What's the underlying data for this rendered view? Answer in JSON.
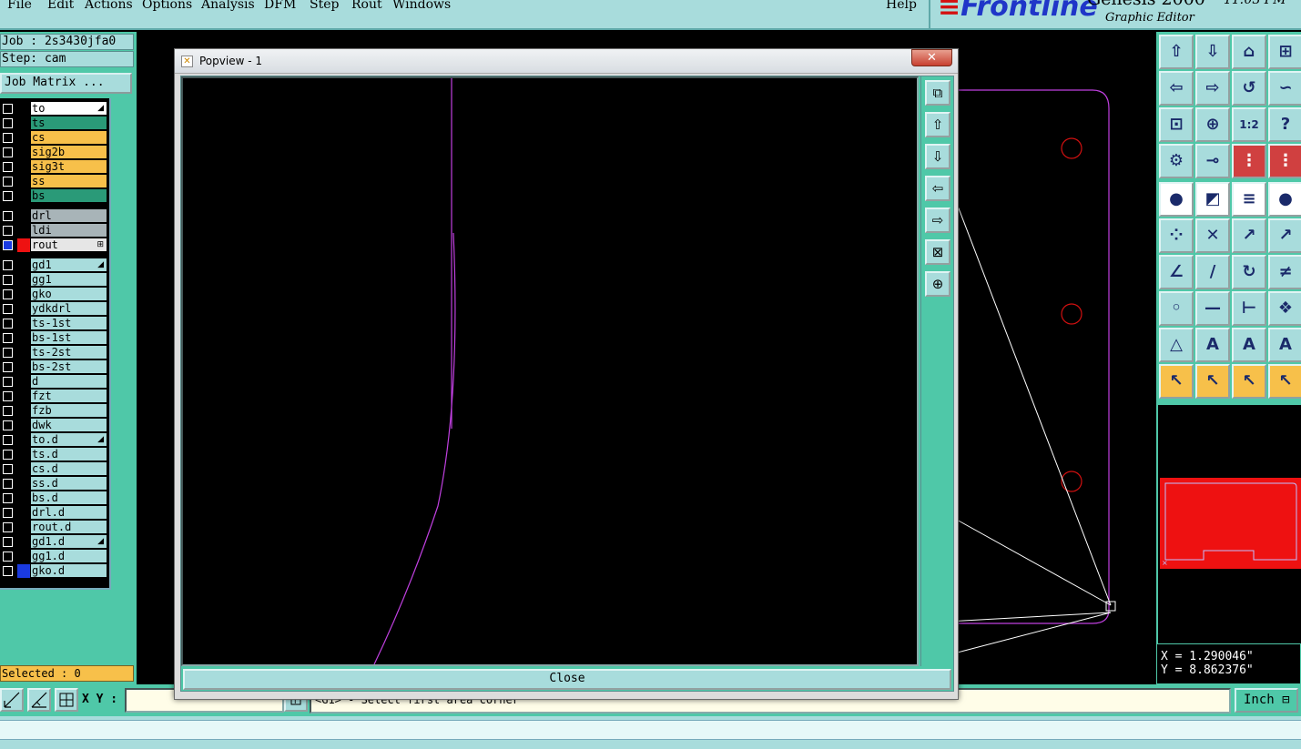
{
  "menubar": {
    "items": [
      "File",
      "Edit",
      "Actions",
      "Options",
      "Analysis",
      "DFM",
      "Step",
      "Rout",
      "Windows"
    ],
    "help": "Help"
  },
  "brand": {
    "logo": "Frontline",
    "product": "Genesis 2000",
    "subtitle": "Graphic Editor",
    "time": "11:03 PM"
  },
  "job": {
    "job_label": "Job : 2s3430jfa0",
    "step_label": "Step: cam",
    "matrix_button": "Job Matrix ..."
  },
  "layers": [
    {
      "name": "to",
      "bg": "#ffffff",
      "color": "#000000",
      "mark": "◢"
    },
    {
      "name": "ts",
      "bg": "#2a9a78",
      "color": "#000000",
      "mark": ""
    },
    {
      "name": "cs",
      "bg": "#f7c04a",
      "color": "#000000",
      "mark": ""
    },
    {
      "name": "sig2b",
      "bg": "#f7c04a",
      "color": "#000000",
      "mark": ""
    },
    {
      "name": "sig3t",
      "bg": "#f7c04a",
      "color": "#000000",
      "mark": ""
    },
    {
      "name": "ss",
      "bg": "#f7c04a",
      "color": "#000000",
      "mark": ""
    },
    {
      "name": "bs",
      "bg": "#2a9a78",
      "color": "#000000",
      "mark": ""
    },
    {
      "name": "drl",
      "bg": "#a8b4b8",
      "color": "#000000",
      "mark": ""
    },
    {
      "name": "ldi",
      "bg": "#a8b4b8",
      "color": "#000000",
      "mark": ""
    },
    {
      "name": "rout",
      "bg": "#e6e6e6",
      "color": "#ee1111",
      "mark": "⊞"
    },
    {
      "name": "gd1",
      "bg": "#a8dcdc",
      "color": "#000000",
      "mark": "◢"
    },
    {
      "name": "gg1",
      "bg": "#a8dcdc",
      "color": "#000000",
      "mark": ""
    },
    {
      "name": "gko",
      "bg": "#a8dcdc",
      "color": "#000000",
      "mark": ""
    },
    {
      "name": "ydkdrl",
      "bg": "#a8dcdc",
      "color": "#000000",
      "mark": ""
    },
    {
      "name": "ts-1st",
      "bg": "#a8dcdc",
      "color": "#000000",
      "mark": ""
    },
    {
      "name": "bs-1st",
      "bg": "#a8dcdc",
      "color": "#000000",
      "mark": ""
    },
    {
      "name": "ts-2st",
      "bg": "#a8dcdc",
      "color": "#000000",
      "mark": ""
    },
    {
      "name": "bs-2st",
      "bg": "#a8dcdc",
      "color": "#000000",
      "mark": ""
    },
    {
      "name": "d",
      "bg": "#a8dcdc",
      "color": "#000000",
      "mark": ""
    },
    {
      "name": "fzt",
      "bg": "#a8dcdc",
      "color": "#000000",
      "mark": ""
    },
    {
      "name": "fzb",
      "bg": "#a8dcdc",
      "color": "#000000",
      "mark": ""
    },
    {
      "name": "dwk",
      "bg": "#a8dcdc",
      "color": "#000000",
      "mark": ""
    },
    {
      "name": "to.d",
      "bg": "#a8dcdc",
      "color": "#000000",
      "mark": "◢"
    },
    {
      "name": "ts.d",
      "bg": "#a8dcdc",
      "color": "#000000",
      "mark": ""
    },
    {
      "name": "cs.d",
      "bg": "#a8dcdc",
      "color": "#000000",
      "mark": ""
    },
    {
      "name": "ss.d",
      "bg": "#a8dcdc",
      "color": "#000000",
      "mark": ""
    },
    {
      "name": "bs.d",
      "bg": "#a8dcdc",
      "color": "#000000",
      "mark": ""
    },
    {
      "name": "drl.d",
      "bg": "#a8dcdc",
      "color": "#000000",
      "mark": ""
    },
    {
      "name": "rout.d",
      "bg": "#a8dcdc",
      "color": "#000000",
      "mark": ""
    },
    {
      "name": "gd1.d",
      "bg": "#a8dcdc",
      "color": "#000000",
      "mark": "◢"
    },
    {
      "name": "gg1.d",
      "bg": "#a8dcdc",
      "color": "#000000",
      "mark": ""
    },
    {
      "name": "gko.d",
      "bg": "#a8dcdc",
      "color": "#1a3ae0",
      "mark": ""
    }
  ],
  "selected": "Selected : 0",
  "coords": {
    "x": "X = 1.290046\"",
    "y": "Y = 8.862376\""
  },
  "bottom": {
    "xy_label": "X Y :",
    "xy_value": "",
    "message": "<G1> - Select first area corner",
    "unit": "Inch"
  },
  "popview": {
    "title": "Popview - 1",
    "close_label": "Close",
    "close_x": "✕"
  },
  "right_toolbar": {
    "icons": [
      "zoom-home-icon",
      "pan-down-icon",
      "home-icon",
      "grid-icon",
      "pan-left-icon",
      "pan-right-icon",
      "undo-zoom-icon",
      "snap-icon",
      "fit-all-icon",
      "zoom-fit-icon",
      "ratio-1-2-icon",
      "help-icon",
      "layer-view-icon",
      "pad-icon",
      "layers-active-icon",
      "layers-alt-icon",
      "add-pad-icon",
      "add-surface-icon",
      "measure-icon",
      "circle-icon",
      "connect-nodes-icon",
      "delete-point-icon",
      "move-point-icon",
      "line-point-icon",
      "angle-icon",
      "line-icon",
      "arc-icon",
      "mirror-icon",
      "insert-pad-icon",
      "line-dash-icon",
      "dimension-icon",
      "shapes-icon",
      "text-small-icon",
      "text-a-icon",
      "text-large-icon",
      "text-strike-icon",
      "select-arrow-icon",
      "select-box-icon",
      "select-lasso-icon",
      "select-route-icon"
    ]
  },
  "popview_tools": {
    "icons": [
      "pv-snapshot-icon",
      "pv-pan-up-icon",
      "pv-pan-down-icon",
      "pv-pan-left-icon",
      "pv-pan-right-icon",
      "pv-zoom-in-icon",
      "pv-zoom-out-icon"
    ]
  }
}
